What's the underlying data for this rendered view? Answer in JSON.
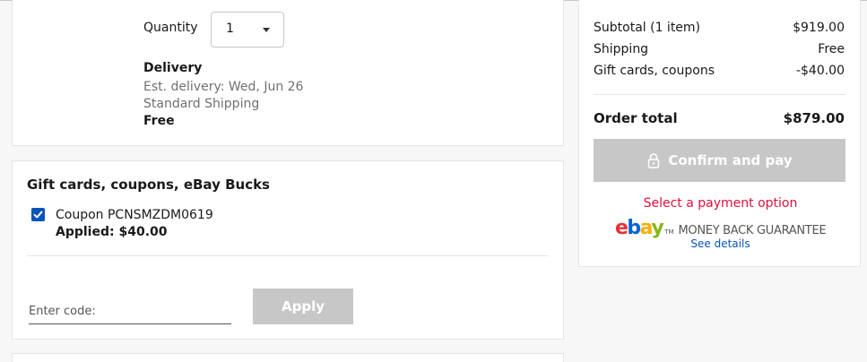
{
  "item": {
    "quantity_label": "Quantity",
    "quantity_value": "1",
    "delivery_title": "Delivery",
    "est_delivery": "Est. delivery: Wed, Jun 26",
    "shipping_method": "Standard Shipping",
    "shipping_cost": "Free"
  },
  "coupons": {
    "title": "Gift cards, coupons, eBay Bucks",
    "coupon_checked": true,
    "coupon_code": "Coupon PCNSMZDM0619",
    "applied": "Applied: $40.00",
    "input_placeholder": "Enter code:",
    "apply_label": "Apply"
  },
  "summary": {
    "rows": [
      {
        "label": "Subtotal (1 item)",
        "value": "$919.00"
      },
      {
        "label": "Shipping",
        "value": "Free"
      },
      {
        "label": "Gift cards, coupons",
        "value": "-$40.00"
      }
    ],
    "total_label": "Order total",
    "total_value": "$879.00",
    "confirm_label": "Confirm and pay",
    "warning": "Select a payment option",
    "logo_letters": [
      "e",
      "b",
      "a",
      "y"
    ],
    "logo_tm": "TM",
    "guarantee": "MONEY BACK GUARANTEE",
    "see_details": "See details"
  },
  "colors": {
    "disabled_button": "#c7c7c7",
    "link": "#0654ba",
    "warning": "#e0103a",
    "checkbox": "#0654ba"
  },
  "icons": {
    "quantity_caret": "chevron-down-icon",
    "checkbox": "checkmark-icon",
    "confirm": "lock-icon"
  }
}
